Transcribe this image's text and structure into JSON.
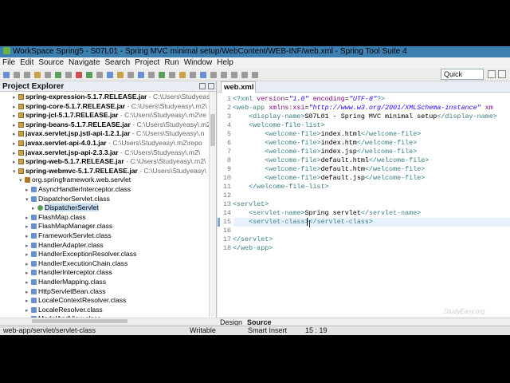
{
  "window": {
    "title": "WorkSpace Spring5 - S07L01 - Spring MVC minimal setup/WebContent/WEB-INF/web.xml - Spring Tool Suite 4"
  },
  "menu": [
    "File",
    "Edit",
    "Source",
    "Navigate",
    "Search",
    "Project",
    "Run",
    "Window",
    "Help"
  ],
  "toolbar": {
    "quick_access": "Quick Access"
  },
  "project_explorer": {
    "title": "Project Explorer",
    "items": [
      {
        "label": "spring-expression-5.1.7.RELEASE.jar",
        "path": " - C:\\Users\\Studyeas",
        "kind": "jar",
        "indent": 1
      },
      {
        "label": "spring-core-5.1.7.RELEASE.jar",
        "path": " - C:\\Users\\Studyeasy\\.m2\\",
        "kind": "jar",
        "indent": 1
      },
      {
        "label": "spring-jcl-5.1.7.RELEASE.jar",
        "path": " - C:\\Users\\Studyeasy\\.m2\\re",
        "kind": "jar",
        "indent": 1
      },
      {
        "label": "spring-beans-5.1.7.RELEASE.jar",
        "path": " - C:\\Users\\Studyeasy\\.m2\\",
        "kind": "jar",
        "indent": 1
      },
      {
        "label": "javax.servlet.jsp.jstl-api-1.2.1.jar",
        "path": " - C:\\Users\\Studyeasy\\.n",
        "kind": "jar",
        "indent": 1
      },
      {
        "label": "javax.servlet-api-4.0.1.jar",
        "path": " - C:\\Users\\Studyeasy\\.m2\\repo",
        "kind": "jar",
        "indent": 1
      },
      {
        "label": "javax.servlet.jsp-api-2.3.3.jar",
        "path": " - C:\\Users\\Studyeasy\\.m2\\",
        "kind": "jar",
        "indent": 1
      },
      {
        "label": "spring-web-5.1.7.RELEASE.jar",
        "path": " - C:\\Users\\Studyeasy\\.m2\\",
        "kind": "jar",
        "indent": 1
      },
      {
        "label": "spring-webmvc-5.1.7.RELEASE.jar",
        "path": " - C:\\Users\\Studyeasy\\",
        "kind": "jar",
        "indent": 1,
        "expanded": true
      },
      {
        "label": "org.springframework.web.servlet",
        "path": "",
        "kind": "pkg",
        "indent": 2,
        "expanded": true
      },
      {
        "label": "AsyncHandlerInterceptor.class",
        "path": "",
        "kind": "cls",
        "indent": 3
      },
      {
        "label": "DispatcherServlet.class",
        "path": "",
        "kind": "cls",
        "indent": 3,
        "expanded": true
      },
      {
        "label": "DispatcherServlet",
        "path": "",
        "kind": "clsg",
        "indent": 4,
        "selected": true
      },
      {
        "label": "FlashMap.class",
        "path": "",
        "kind": "cls",
        "indent": 3
      },
      {
        "label": "FlashMapManager.class",
        "path": "",
        "kind": "cls",
        "indent": 3
      },
      {
        "label": "FrameworkServlet.class",
        "path": "",
        "kind": "cls",
        "indent": 3
      },
      {
        "label": "HandlerAdapter.class",
        "path": "",
        "kind": "cls",
        "indent": 3
      },
      {
        "label": "HandlerExceptionResolver.class",
        "path": "",
        "kind": "cls",
        "indent": 3
      },
      {
        "label": "HandlerExecutionChain.class",
        "path": "",
        "kind": "cls",
        "indent": 3
      },
      {
        "label": "HandlerInterceptor.class",
        "path": "",
        "kind": "cls",
        "indent": 3
      },
      {
        "label": "HandlerMapping.class",
        "path": "",
        "kind": "cls",
        "indent": 3
      },
      {
        "label": "HttpServletBean.class",
        "path": "",
        "kind": "cls",
        "indent": 3
      },
      {
        "label": "LocaleContextResolver.class",
        "path": "",
        "kind": "cls",
        "indent": 3
      },
      {
        "label": "LocaleResolver.class",
        "path": "",
        "kind": "cls",
        "indent": 3
      },
      {
        "label": "ModelAndView.class",
        "path": "",
        "kind": "cls",
        "indent": 3
      }
    ]
  },
  "editor": {
    "tab": "web.xml",
    "lines": [
      {
        "n": "1",
        "html": "<span class=\"tag\">&lt;?</span><span class=\"tagn\">xml</span> <span class=\"attr\">version</span>=<span class=\"val\">\"1.0\"</span> <span class=\"attr\">encoding</span>=<span class=\"val\">\"UTF-8\"</span><span class=\"tag\">?&gt;</span>"
      },
      {
        "n": "2",
        "html": "<span class=\"tag\">&lt;</span><span class=\"tagn\">web-app</span> <span class=\"attr\">xmlns:xsi</span>=<span class=\"val\">\"http://www.w3.org/2001/XMLSchema-instance\"</span> <span class=\"attr\">xm</span>"
      },
      {
        "n": "3",
        "html": "    <span class=\"tag\">&lt;</span><span class=\"tagn\">display-name</span><span class=\"tag\">&gt;</span><span class=\"txt\">S07L01 - Spring MVC minimal setup</span><span class=\"tag\">&lt;/</span><span class=\"tagn\">display-name</span><span class=\"tag\">&gt;</span>"
      },
      {
        "n": "4",
        "html": "    <span class=\"tag\">&lt;</span><span class=\"tagn\">welcome-file-list</span><span class=\"tag\">&gt;</span>"
      },
      {
        "n": "5",
        "html": "        <span class=\"tag\">&lt;</span><span class=\"tagn\">welcome-file</span><span class=\"tag\">&gt;</span><span class=\"txt\">index.html</span><span class=\"tag\">&lt;/</span><span class=\"tagn\">welcome-file</span><span class=\"tag\">&gt;</span>"
      },
      {
        "n": "6",
        "html": "        <span class=\"tag\">&lt;</span><span class=\"tagn\">welcome-file</span><span class=\"tag\">&gt;</span><span class=\"txt\">index.htm</span><span class=\"tag\">&lt;/</span><span class=\"tagn\">welcome-file</span><span class=\"tag\">&gt;</span>"
      },
      {
        "n": "7",
        "html": "        <span class=\"tag\">&lt;</span><span class=\"tagn\">welcome-file</span><span class=\"tag\">&gt;</span><span class=\"txt\">index.jsp</span><span class=\"tag\">&lt;/</span><span class=\"tagn\">welcome-file</span><span class=\"tag\">&gt;</span>"
      },
      {
        "n": "8",
        "html": "        <span class=\"tag\">&lt;</span><span class=\"tagn\">welcome-file</span><span class=\"tag\">&gt;</span><span class=\"txt\">default.html</span><span class=\"tag\">&lt;/</span><span class=\"tagn\">welcome-file</span><span class=\"tag\">&gt;</span>"
      },
      {
        "n": "9",
        "html": "        <span class=\"tag\">&lt;</span><span class=\"tagn\">welcome-file</span><span class=\"tag\">&gt;</span><span class=\"txt\">default.htm</span><span class=\"tag\">&lt;/</span><span class=\"tagn\">welcome-file</span><span class=\"tag\">&gt;</span>"
      },
      {
        "n": "10",
        "html": "        <span class=\"tag\">&lt;</span><span class=\"tagn\">welcome-file</span><span class=\"tag\">&gt;</span><span class=\"txt\">default.jsp</span><span class=\"tag\">&lt;/</span><span class=\"tagn\">welcome-file</span><span class=\"tag\">&gt;</span>"
      },
      {
        "n": "11",
        "html": "    <span class=\"tag\">&lt;/</span><span class=\"tagn\">welcome-file-list</span><span class=\"tag\">&gt;</span>"
      },
      {
        "n": "12",
        "html": ""
      },
      {
        "n": "13",
        "html": "<span class=\"tag\">&lt;</span><span class=\"tagn\">servlet</span><span class=\"tag\">&gt;</span>"
      },
      {
        "n": "14",
        "html": "    <span class=\"tag\">&lt;</span><span class=\"tagn\">servlet-name</span><span class=\"tag\">&gt;</span><span class=\"txt\">Spring servlet</span><span class=\"tag\">&lt;/</span><span class=\"tagn\">servlet-name</span><span class=\"tag\">&gt;</span>"
      },
      {
        "n": "15",
        "html": "    <span class=\"tag\">&lt;</span><span class=\"tagn\">servlet-class</span><span class=\"tag\">&gt;</span><span class=\"tag\">&lt;/</span><span class=\"tagn\">servlet-class</span><span class=\"tag\">&gt;</span>"
      },
      {
        "n": "16",
        "html": ""
      },
      {
        "n": "17",
        "html": "<span class=\"tag\">&lt;/</span><span class=\"tagn\">servlet</span><span class=\"tag\">&gt;</span>"
      },
      {
        "n": "18",
        "html": "<span class=\"tag\">&lt;/</span><span class=\"tagn\">web-app</span><span class=\"tag\">&gt;</span>"
      }
    ],
    "current_line": 15
  },
  "design_tabs": [
    "Design",
    "Source"
  ],
  "status": {
    "path": "web-app/servlet/servlet-class",
    "mode": "Writable",
    "insert": "Smart Insert",
    "position": "15 : 19"
  },
  "watermark": "StudyEasy.org"
}
